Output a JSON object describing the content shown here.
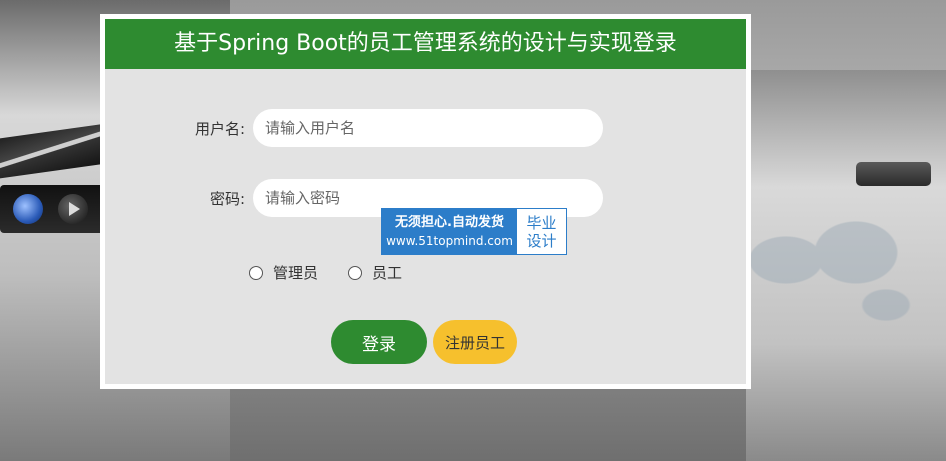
{
  "header": {
    "title": "基于Spring Boot的员工管理系统的设计与实现登录"
  },
  "form": {
    "username_label": "用户名:",
    "username_placeholder": "请输入用户名",
    "password_label": "密码:",
    "password_placeholder": "请输入密码",
    "roles": [
      {
        "label": "管理员"
      },
      {
        "label": "员工"
      }
    ]
  },
  "buttons": {
    "login": "登录",
    "register": "注册员工"
  },
  "watermark": {
    "line1": "无须担心.自动发货",
    "line2": "www.51topmind.com",
    "badge_line1": "毕业",
    "badge_line2": "设计"
  },
  "colors": {
    "header_green": "#2e8b30",
    "register_yellow": "#f6c02d",
    "watermark_blue": "#2c7dc9"
  }
}
